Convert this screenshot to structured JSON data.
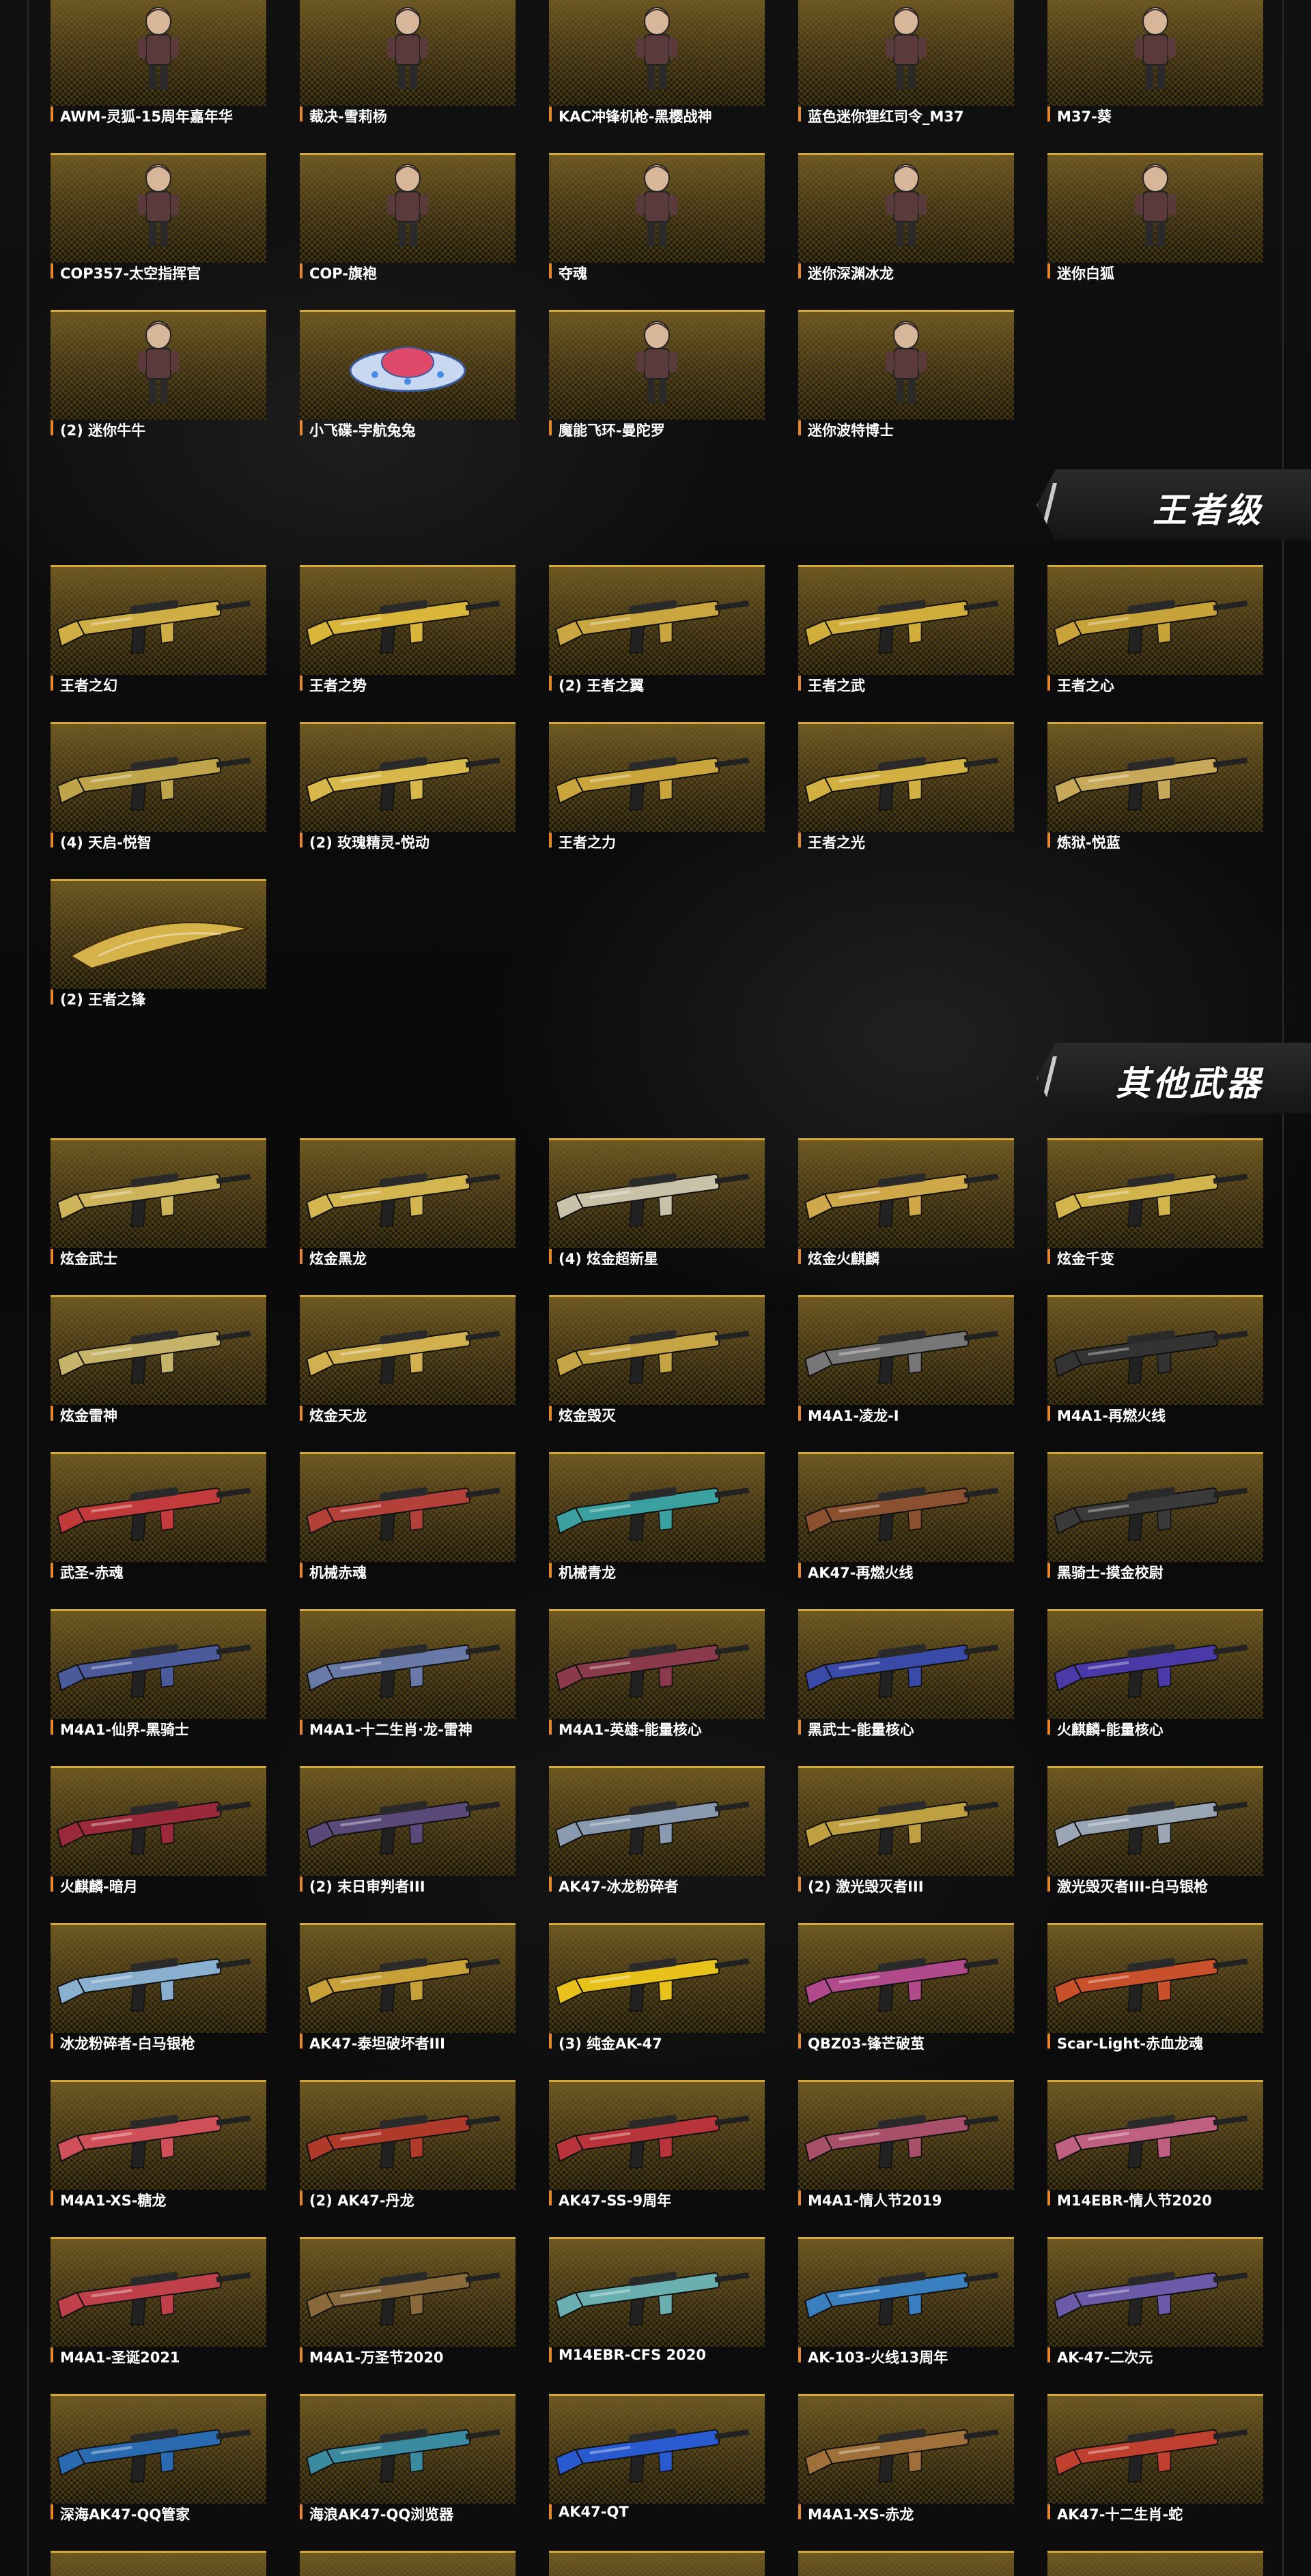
{
  "sections": [
    {
      "id": "mini",
      "title": "",
      "items": [
        {
          "label": "AWM-灵狐-15周年嘉年华",
          "kind": "figure"
        },
        {
          "label": "裁决-雪莉杨",
          "kind": "figure"
        },
        {
          "label": "KAC冲锋机枪-黑樱战神",
          "kind": "figure"
        },
        {
          "label": "蓝色迷你狸红司令_M37",
          "kind": "figure"
        },
        {
          "label": "M37-葵",
          "kind": "figure"
        },
        {
          "label": "COP357-太空指挥官",
          "kind": "figure"
        },
        {
          "label": "COP-旗袍",
          "kind": "figure"
        },
        {
          "label": "夺魂",
          "kind": "figure"
        },
        {
          "label": "迷你深渊冰龙",
          "kind": "figure"
        },
        {
          "label": "迷你白狐",
          "kind": "figure"
        },
        {
          "label": "(2) 迷你牛牛",
          "kind": "figure"
        },
        {
          "label": "小飞碟-宇航兔兔",
          "kind": "ufo"
        },
        {
          "label": "魔能飞环-曼陀罗",
          "kind": "figure"
        },
        {
          "label": "迷你波特博士",
          "kind": "figure"
        }
      ]
    },
    {
      "id": "king",
      "title": "王者级",
      "items": [
        {
          "label": "王者之幻",
          "kind": "gun",
          "color": "#cfae45"
        },
        {
          "label": "王者之势",
          "kind": "gun",
          "color": "#d9b53a"
        },
        {
          "label": "(2) 王者之翼",
          "kind": "gun",
          "color": "#c9a640"
        },
        {
          "label": "王者之武",
          "kind": "gun",
          "color": "#d1ad3c"
        },
        {
          "label": "王者之心",
          "kind": "gun",
          "color": "#c8a33a"
        },
        {
          "label": "(4) 天启-悦智",
          "kind": "gun",
          "color": "#bfa44a"
        },
        {
          "label": "(2) 玫瑰精灵-悦动",
          "kind": "gun",
          "color": "#d8b84a"
        },
        {
          "label": "王者之力",
          "kind": "gun",
          "color": "#c9a53c"
        },
        {
          "label": "王者之光",
          "kind": "gun",
          "color": "#d2b042"
        },
        {
          "label": "炼狱-悦蓝",
          "kind": "gun",
          "color": "#c8a95a"
        },
        {
          "label": "(2) 王者之锋",
          "kind": "knife",
          "color": "#d6b24a"
        }
      ]
    },
    {
      "id": "other",
      "title": "其他武器",
      "items": [
        {
          "label": "炫金武士",
          "kind": "gun",
          "color": "#cdb45a"
        },
        {
          "label": "炫金黑龙",
          "kind": "gun",
          "color": "#d4b650"
        },
        {
          "label": "(4) 炫金超新星",
          "kind": "gun",
          "color": "#c9c2a8"
        },
        {
          "label": "炫金火麒麟",
          "kind": "gun",
          "color": "#cfa84a"
        },
        {
          "label": "炫金千变",
          "kind": "gun",
          "color": "#d1b44c"
        },
        {
          "label": "炫金雷神",
          "kind": "gun",
          "color": "#c6b36a"
        },
        {
          "label": "炫金天龙",
          "kind": "gun",
          "color": "#d1b050"
        },
        {
          "label": "炫金毁灭",
          "kind": "gun",
          "color": "#c4a443"
        },
        {
          "label": "M4A1-凌龙-I",
          "kind": "gun",
          "color": "#777777"
        },
        {
          "label": "M4A1-再燃火线",
          "kind": "gun",
          "color": "#333333"
        },
        {
          "label": "武圣-赤魂",
          "kind": "gun",
          "color": "#c33a3a"
        },
        {
          "label": "机械赤魂",
          "kind": "gun",
          "color": "#b4403a"
        },
        {
          "label": "机械青龙",
          "kind": "gun",
          "color": "#3aa0a0"
        },
        {
          "label": "AK47-再燃火线",
          "kind": "gun",
          "color": "#8a5030"
        },
        {
          "label": "黑骑士-摸金校尉",
          "kind": "gun",
          "color": "#3a3a3a"
        },
        {
          "label": "M4A1-仙界-黑骑士",
          "kind": "gun",
          "color": "#4a5a9a"
        },
        {
          "label": "M4A1-十二生肖·龙-雷神",
          "kind": "gun",
          "color": "#6a7aa8"
        },
        {
          "label": "M4A1-英雄-能量核心",
          "kind": "gun",
          "color": "#8a3a4a"
        },
        {
          "label": "黑武士-能量核心",
          "kind": "gun",
          "color": "#3a4aa8"
        },
        {
          "label": "火麒麟-能量核心",
          "kind": "gun",
          "color": "#4a3aa8"
        },
        {
          "label": "火麒麟-暗月",
          "kind": "gun",
          "color": "#9a2a3a"
        },
        {
          "label": "(2) 末日审判者III",
          "kind": "gun",
          "color": "#5a4a7a"
        },
        {
          "label": "AK47-冰龙粉碎者",
          "kind": "gun",
          "color": "#8a9ab0"
        },
        {
          "label": "(2) 激光毁灭者III",
          "kind": "gun",
          "color": "#bfa040"
        },
        {
          "label": "激光毁灭者III-白马银枪",
          "kind": "gun",
          "color": "#9aa6b4"
        },
        {
          "label": "冰龙粉碎者-白马银枪",
          "kind": "gun",
          "color": "#8ab0d0"
        },
        {
          "label": "AK47-泰坦破坏者III",
          "kind": "gun",
          "color": "#c8a038"
        },
        {
          "label": "(3) 纯金AK-47",
          "kind": "gun",
          "color": "#e8c21a"
        },
        {
          "label": "QBZ03-锋芒破茧",
          "kind": "gun",
          "color": "#b04a8a"
        },
        {
          "label": "Scar-Light-赤血龙魂",
          "kind": "gun",
          "color": "#c8502a"
        },
        {
          "label": "M4A1-XS-糖龙",
          "kind": "gun",
          "color": "#d0505a"
        },
        {
          "label": "(2) AK47-丹龙",
          "kind": "gun",
          "color": "#b03a2a"
        },
        {
          "label": "AK47-SS-9周年",
          "kind": "gun",
          "color": "#b8343a"
        },
        {
          "label": "M4A1-情人节2019",
          "kind": "gun",
          "color": "#a8506a"
        },
        {
          "label": "M14EBR-情人节2020",
          "kind": "gun",
          "color": "#c06080"
        },
        {
          "label": "M4A1-圣诞2021",
          "kind": "gun",
          "color": "#c0404a"
        },
        {
          "label": "M4A1-万圣节2020",
          "kind": "gun",
          "color": "#8a6a3a"
        },
        {
          "label": "M14EBR-CFS 2020",
          "kind": "gun",
          "color": "#6ab0b0"
        },
        {
          "label": "AK-103-火线13周年",
          "kind": "gun",
          "color": "#3a80c0"
        },
        {
          "label": "AK-47-二次元",
          "kind": "gun",
          "color": "#6a5aa8"
        },
        {
          "label": "深海AK47-QQ管家",
          "kind": "gun",
          "color": "#2a6ab0"
        },
        {
          "label": "海浪AK47-QQ浏览器",
          "kind": "gun",
          "color": "#3a8aa0"
        },
        {
          "label": "AK47-QT",
          "kind": "gun",
          "color": "#2a5ad0"
        },
        {
          "label": "M4A1-XS-赤龙",
          "kind": "gun",
          "color": "#a0703a"
        },
        {
          "label": "AK47-十二生肖-蛇",
          "kind": "gun",
          "color": "#c04030"
        }
      ]
    }
  ],
  "partial_row_colors": [
    "#3a8aa0",
    "#6a6a6a",
    "#c0a040",
    "#5a5a5a",
    "#3a70a0"
  ],
  "colors": {
    "accent": "#e8862a",
    "gold": "#d4a93b"
  }
}
